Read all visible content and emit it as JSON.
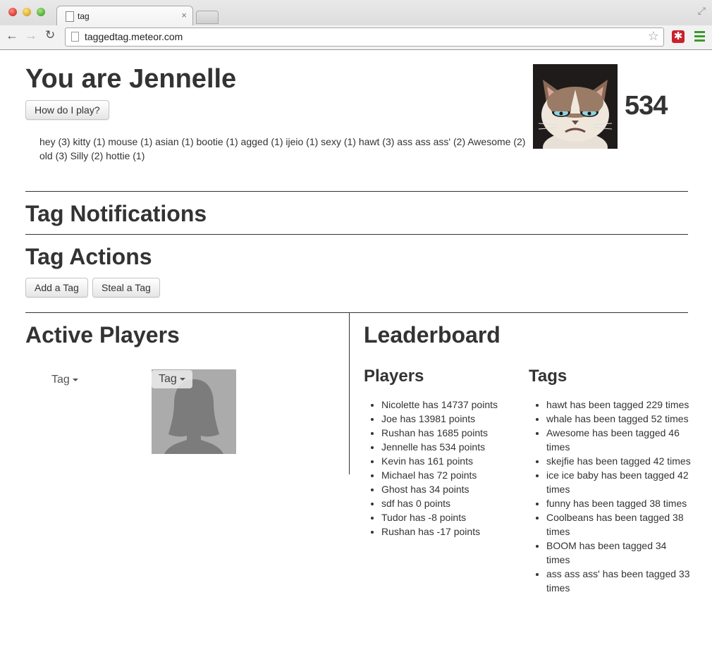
{
  "browser": {
    "tab_title": "tag",
    "url": "taggedtag.meteor.com",
    "close_glyph": "×",
    "star_glyph": "☆",
    "back_glyph": "←",
    "forward_glyph": "→",
    "reload_glyph": "↻",
    "fullscreen_glyph": "⤢"
  },
  "header": {
    "title": "You are Jennelle",
    "help_button": "How do I play?",
    "tags": "hey (3) kitty (1) mouse (1) asian (1) bootie (1) agged (1) ijeio (1) sexy (1) hawt (3) ass ass ass' (2) Awesome (2) old (3) Silly (2) hottie (1)",
    "score": "534",
    "avatar": "grumpy-cat-avatar"
  },
  "notifications": {
    "title": "Tag Notifications"
  },
  "actions": {
    "title": "Tag Actions",
    "add_button": "Add a Tag",
    "steal_button": "Steal a Tag"
  },
  "active_players": {
    "title": "Active Players",
    "tag_dropdown_1": "Tag",
    "tag_dropdown_2": "Tag"
  },
  "leaderboard": {
    "title": "Leaderboard",
    "players_title": "Players",
    "tags_title": "Tags",
    "players": [
      "Nicolette has 14737 points",
      "Joe has 13981 points",
      "Rushan has 1685 points",
      "Jennelle has 534 points",
      "Kevin has 161 points",
      "Michael has 72 points",
      "Ghost has 34 points",
      "sdf has 0 points",
      "Tudor has -8 points",
      "Rushan has -17 points"
    ],
    "tags": [
      "hawt has been tagged 229 times",
      "whale has been tagged 52 times",
      "Awesome has been tagged 46 times",
      "skejfie has been tagged 42 times",
      "ice ice baby has been tagged 42 times",
      "funny has been tagged 38 times",
      "Coolbeans has been tagged 38 times",
      "BOOM has been tagged 34 times",
      "ass ass ass' has been tagged 33 times"
    ]
  }
}
